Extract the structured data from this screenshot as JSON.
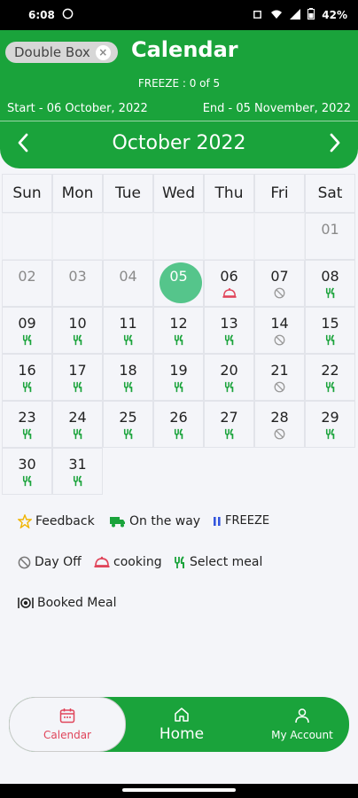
{
  "status": {
    "time": "6:08",
    "battery": "42%"
  },
  "header": {
    "chip": "Double Box",
    "title": "Calendar",
    "freeze": "FREEZE : 0 of 5",
    "start": "Start - 06 October, 2022",
    "end": "End - 05 November, 2022",
    "month": "October 2022"
  },
  "weekdays": [
    "Sun",
    "Mon",
    "Tue",
    "Wed",
    "Thu",
    "Fri",
    "Sat"
  ],
  "legend": {
    "feedback": "Feedback",
    "on_the_way": "On the way",
    "freeze": "FREEZE",
    "day_off": "Day Off",
    "cooking": "cooking",
    "select_meal": "Select meal",
    "booked_meal": "Booked Meal"
  },
  "nav": {
    "calendar": "Calendar",
    "home": "Home",
    "account": "My Account"
  },
  "colors": {
    "primary": "#1aa33b",
    "today": "#55c58b",
    "accent": "#e0455a"
  }
}
